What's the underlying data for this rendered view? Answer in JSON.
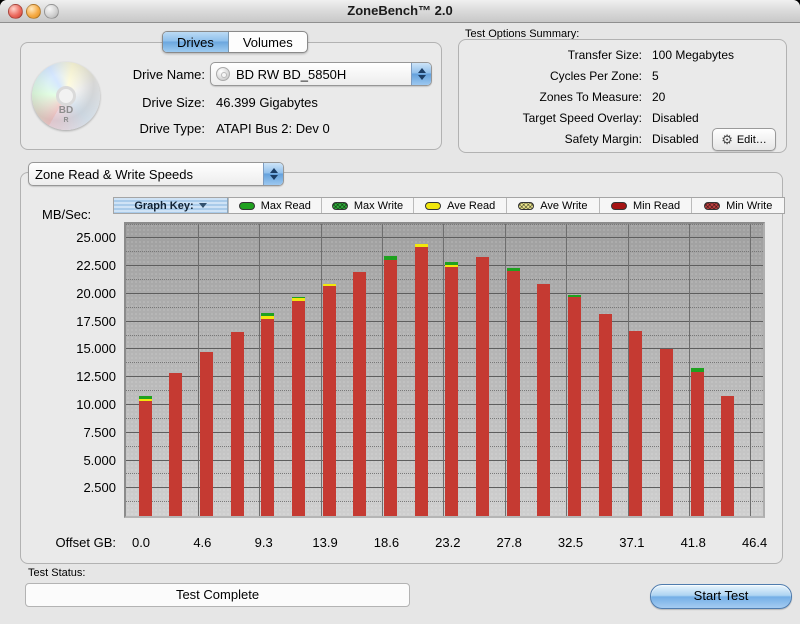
{
  "window": {
    "title": "ZoneBench™ 2.0"
  },
  "tabs": {
    "drives": "Drives",
    "volumes": "Volumes"
  },
  "drive_panel": {
    "disc_icon_text": "BD",
    "disc_icon_subtext": "R",
    "name_label": "Drive Name:",
    "name_value": "BD RW BD_5850H",
    "size_label": "Drive Size:",
    "size_value": "46.399 Gigabytes",
    "type_label": "Drive Type:",
    "type_value": "ATAPI Bus 2: Dev 0"
  },
  "test_options": {
    "title": "Test Options Summary:",
    "rows": [
      {
        "label": "Transfer Size:",
        "value": "100 Megabytes"
      },
      {
        "label": "Cycles Per Zone:",
        "value": "5"
      },
      {
        "label": "Zones To Measure:",
        "value": "20"
      },
      {
        "label": "Target Speed Overlay:",
        "value": "Disabled"
      },
      {
        "label": "Safety Margin:",
        "value": "Disabled"
      }
    ],
    "edit_label": "Edit…",
    "edit_icon": "gear-icon"
  },
  "chart_panel": {
    "view_selector": "Zone Read & Write Speeds",
    "legend": {
      "header": "Graph Key:",
      "items": [
        {
          "label": "Max Read",
          "swatch": "green-solid"
        },
        {
          "label": "Max Write",
          "swatch": "green-pattern"
        },
        {
          "label": "Ave Read",
          "swatch": "yellow-solid"
        },
        {
          "label": "Ave Write",
          "swatch": "yellow-pattern"
        },
        {
          "label": "Min Read",
          "swatch": "red-solid"
        },
        {
          "label": "Min Write",
          "swatch": "red-pattern"
        }
      ]
    }
  },
  "chart_data": {
    "type": "bar",
    "title": "Zone Read & Write Speeds",
    "ylabel": "MB/Sec:",
    "xlabel": "Offset GB:",
    "ylim": [
      0,
      26.3
    ],
    "grid": {
      "major_step": 2.5,
      "minor_step": 1.25
    },
    "yticks": [
      "25.000",
      "22.500",
      "20.000",
      "17.500",
      "15.000",
      "12.500",
      "10.000",
      "7.500",
      "5.000",
      "2.500"
    ],
    "ytick_values": [
      25,
      22.5,
      20,
      17.5,
      15,
      12.5,
      10,
      7.5,
      5,
      2.5
    ],
    "x_labels": [
      "0.0",
      "4.6",
      "9.3",
      "13.9",
      "18.6",
      "23.2",
      "27.8",
      "32.5",
      "37.1",
      "41.8",
      "46.4"
    ],
    "zones": 20,
    "series": [
      {
        "name": "Max Read",
        "color": "#1fa11f",
        "values": [
          10.8,
          12.9,
          14.8,
          16.6,
          18.3,
          19.7,
          20.9,
          22.0,
          23.4,
          24.5,
          22.9,
          23.3,
          22.3,
          20.9,
          19.9,
          18.2,
          16.7,
          15.0,
          13.3,
          10.8
        ]
      },
      {
        "name": "Ave Read",
        "color": "#f2e70c",
        "values": [
          10.5,
          12.9,
          14.8,
          16.6,
          18.0,
          19.6,
          20.9,
          22.0,
          23.1,
          24.5,
          22.6,
          23.3,
          22.1,
          20.9,
          19.7,
          18.2,
          16.7,
          15.0,
          13.0,
          10.8
        ]
      },
      {
        "name": "Min Read",
        "color": "#c53a32",
        "values": [
          10.4,
          12.9,
          14.8,
          16.6,
          17.7,
          19.4,
          20.7,
          22.0,
          23.1,
          24.2,
          22.4,
          23.3,
          22.1,
          20.9,
          19.7,
          18.2,
          16.7,
          15.0,
          13.0,
          10.8
        ]
      }
    ]
  },
  "status": {
    "label": "Test Status:",
    "value": "Test Complete",
    "start_button": "Start Test"
  }
}
